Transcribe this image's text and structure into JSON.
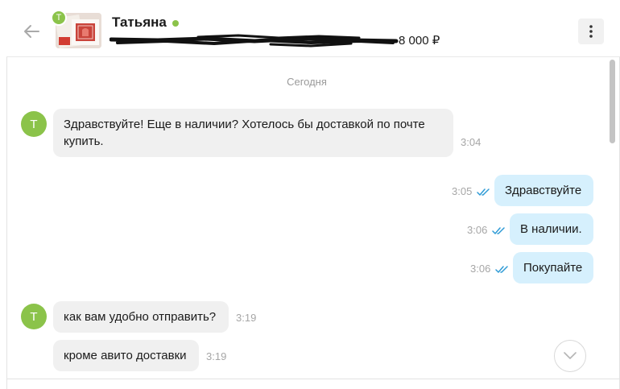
{
  "header": {
    "avatar_letter": "Т",
    "name": "Татьяна",
    "online": true,
    "price": "8 000 ₽"
  },
  "chat": {
    "date_separator": "Сегодня",
    "messages": [
      {
        "direction": "incoming",
        "avatar_letter": "Т",
        "text_line1": "Здравствуйте! Еще в наличии? Хотелось бы доставкой по почте",
        "text_line2": "купить.",
        "time": "3:04"
      },
      {
        "direction": "outgoing",
        "text": "Здравствуйте",
        "time": "3:05",
        "read": true
      },
      {
        "direction": "outgoing",
        "text": "В наличии.",
        "time": "3:06",
        "read": true
      },
      {
        "direction": "outgoing",
        "text": "Покупайте",
        "time": "3:06",
        "read": true
      },
      {
        "direction": "incoming",
        "avatar_letter": "Т",
        "text": "как вам удобно отправить?",
        "time": "3:19"
      },
      {
        "direction": "incoming",
        "text": "кроме авито доставки",
        "time": "3:19"
      }
    ]
  },
  "colors": {
    "accent_green": "#8bc34a",
    "outgoing_bubble": "#d6f0fd",
    "incoming_bubble": "#f0f0f0",
    "read_check": "#2f9bd6"
  },
  "icons": [
    "back-arrow-icon",
    "more-vertical-icon",
    "double-check-icon",
    "chevron-down-icon"
  ]
}
